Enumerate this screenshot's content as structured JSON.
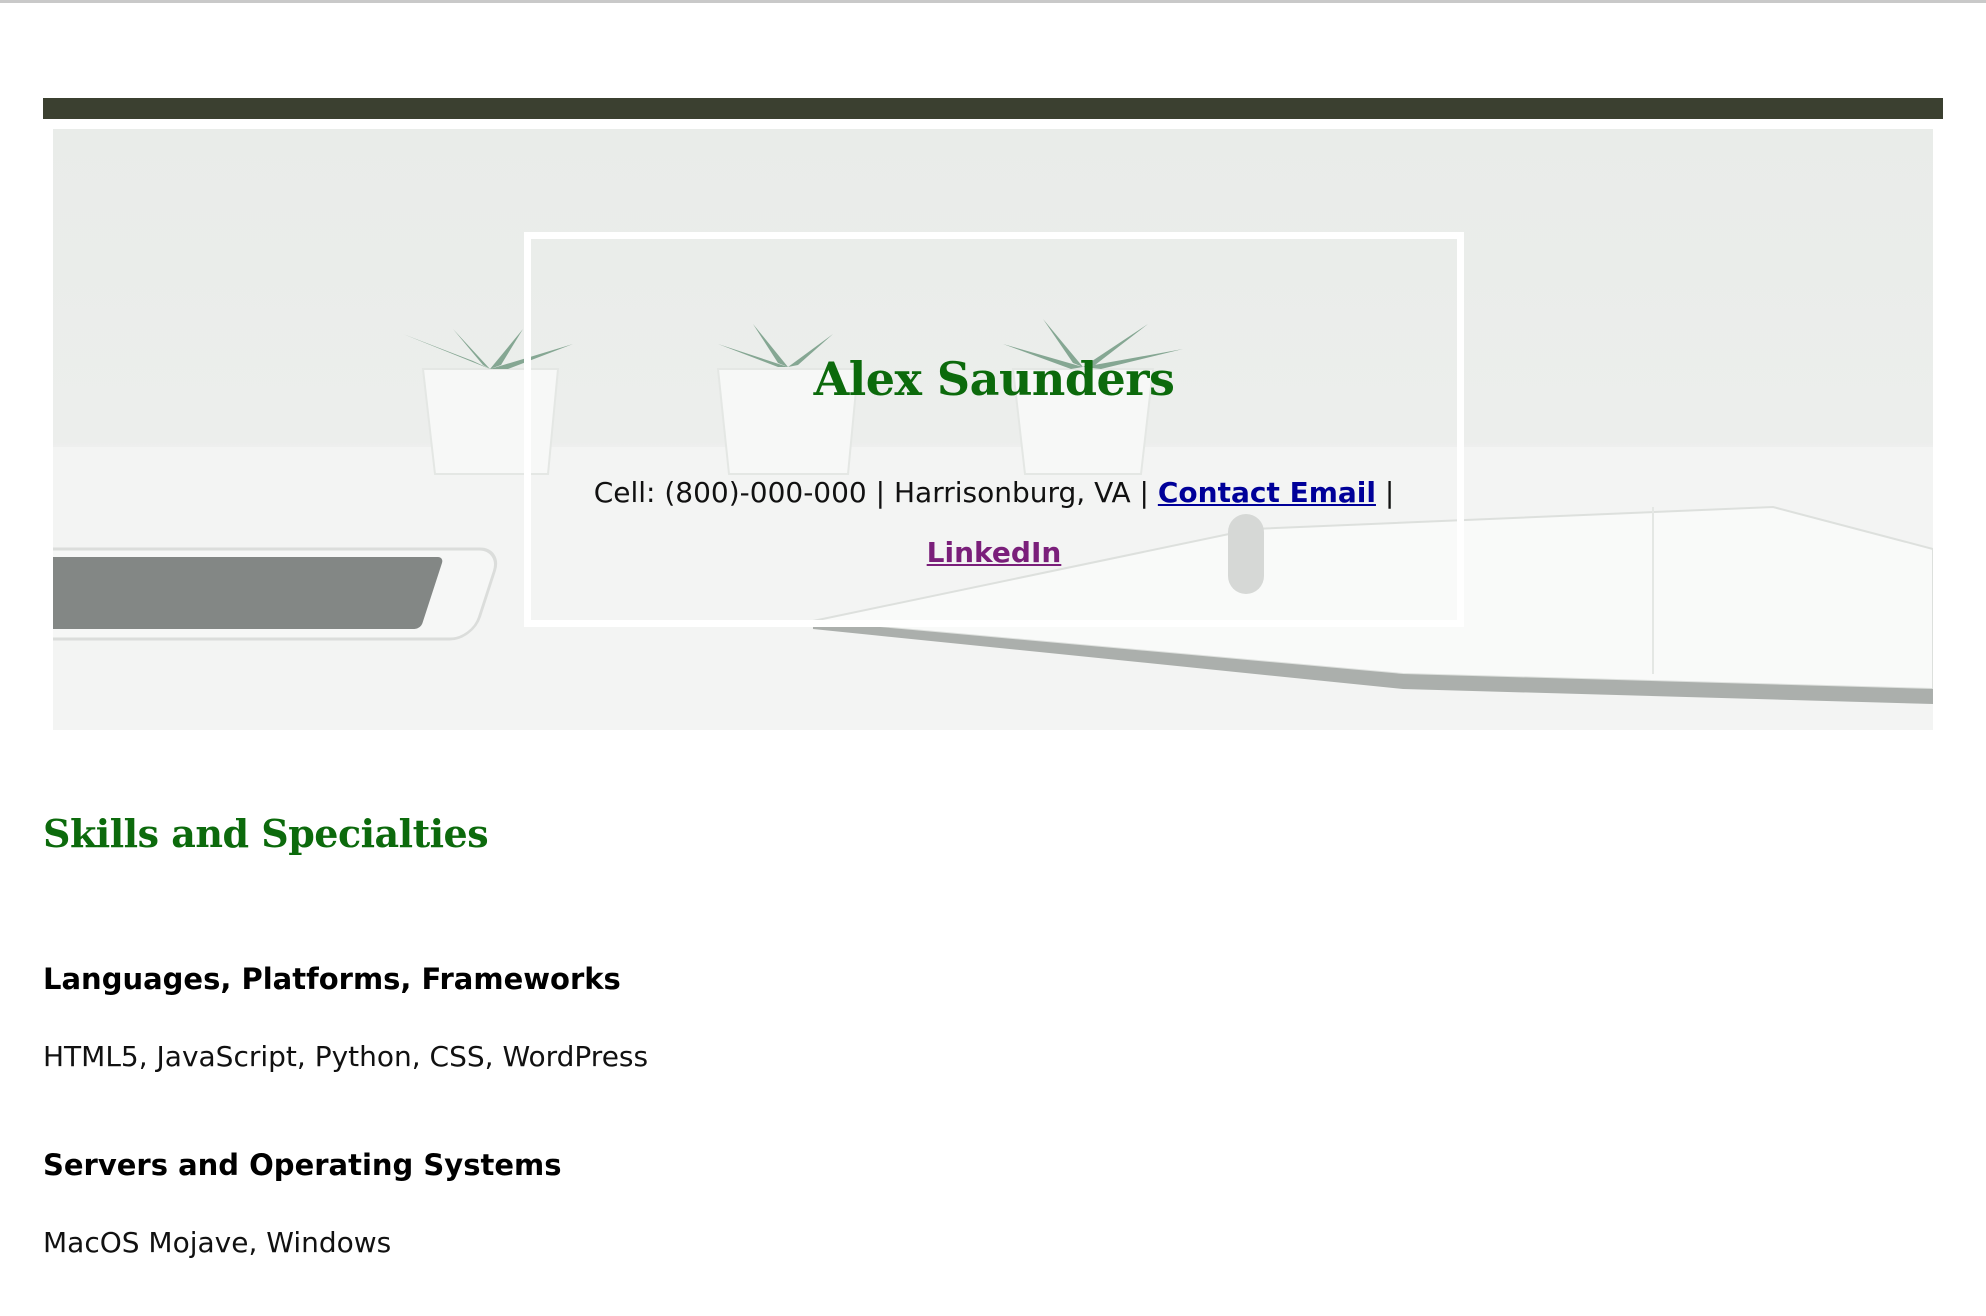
{
  "header": {
    "name": "Alex Saunders",
    "cell": "Cell: (800)-000-000 | Harrisonburg, VA |",
    "email_link": "Contact Email",
    "separator": "|",
    "linkedin_link": "LinkedIn"
  },
  "skills": {
    "title": "Skills and Specialties",
    "groups": [
      {
        "heading": "Languages, Platforms, Frameworks",
        "text": "HTML5, JavaScript, Python, CSS, WordPress"
      },
      {
        "heading": "Servers and Operating Systems",
        "text": "MacOS Mojave, Windows"
      }
    ]
  },
  "colors": {
    "accent_green": "#0c6a0c",
    "dark_bar": "#3b4030",
    "email_link": "#000099",
    "visited_link": "#7a1f7a"
  }
}
